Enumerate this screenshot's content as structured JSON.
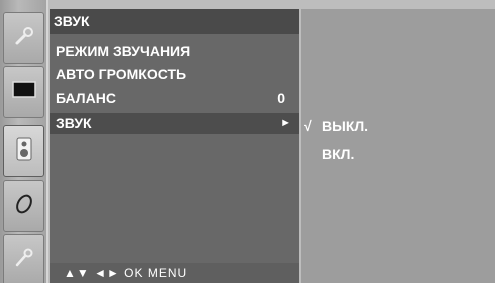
{
  "menu": {
    "title": "ЗВУК",
    "items": [
      {
        "label": "РЕЖИМ ЗВУЧАНИЯ",
        "value": "",
        "arrow": ""
      },
      {
        "label": "АВТО ГРОМКОСТЬ",
        "value": "",
        "arrow": ""
      },
      {
        "label": "БАЛАНС",
        "value": "0",
        "arrow": ""
      },
      {
        "label": "ЗВУК",
        "value": "",
        "arrow": "►",
        "selected": true
      }
    ],
    "nav_hints": "▲▼  ◄►  OK  MENU"
  },
  "submenu": {
    "options": [
      {
        "check": "√",
        "label": "ВЫКЛ.",
        "checked": true
      },
      {
        "check": "",
        "label": "ВКЛ.",
        "checked": false
      }
    ]
  },
  "sidebar": {
    "icons": [
      "wrench-icon",
      "screen-icon",
      "speaker-icon",
      "clock-icon",
      "key-icon"
    ]
  },
  "colors": {
    "menu_bg": "#686868",
    "title_bg": "#4a4a4a",
    "selected_bg": "#4d4d4d",
    "submenu_bg": "#9d9d9d",
    "text": "#ffffff"
  }
}
